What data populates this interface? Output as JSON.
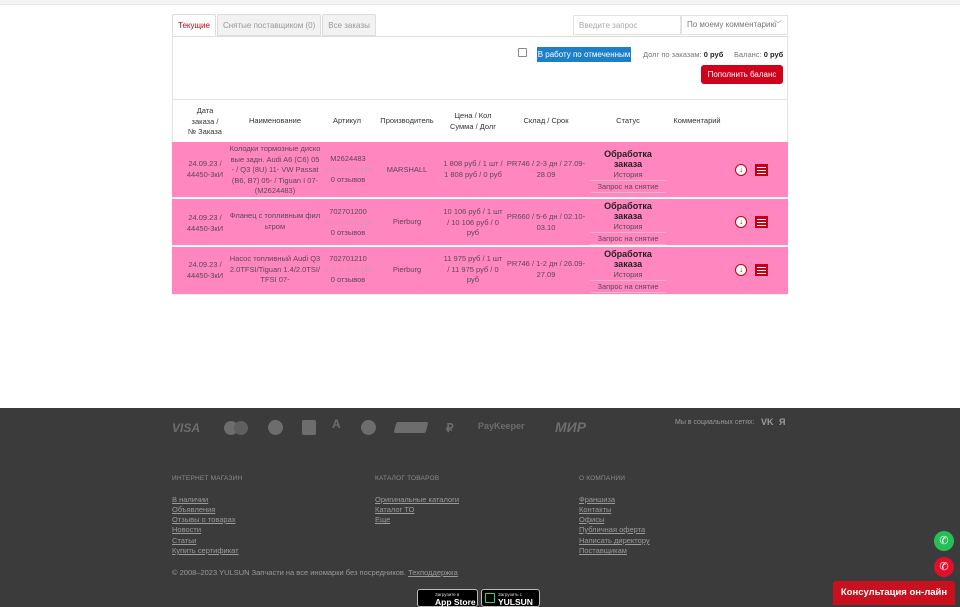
{
  "tabs": [
    {
      "label": "Текущие"
    },
    {
      "label": "Снятые поставщиком (0)"
    },
    {
      "label": "Все заказы"
    }
  ],
  "search": {
    "placeholder": "Введите запрос"
  },
  "filter": {
    "selected": "По моему комментарию"
  },
  "toolbar": {
    "bulk_button": "В работу по отмеченным",
    "debt_label": "Долг по заказам:",
    "debt_value": "0  руб",
    "balance_label": "Баланс:",
    "balance_value": "0  руб",
    "topup_button": "Пополнить баланс"
  },
  "table": {
    "headers": {
      "date": [
        "Дата",
        "заказа /",
        "№ Заказа"
      ],
      "name": "Наименование",
      "article": "Артикул",
      "maker": "Производитель",
      "price": [
        "Цена / Кол",
        "Сумма / Долг"
      ],
      "stock": "Склад / Срок",
      "status": "Статус",
      "comment": "Комментарий"
    },
    "rows": [
      {
        "date": [
          "24.09.23 /",
          "44450-3кИ"
        ],
        "name": [
          "Колодки тормозные диско",
          "вые задн. Audi A6 (C6) 05",
          "- / Q3 (8U) 11- VW Passat",
          "(B6, B7) 05- / Tiguan I 07-",
          "(M2624483)"
        ],
        "article": "M2624483",
        "stars": "☆☆☆☆☆(0)",
        "reviews": "0 отзывов",
        "maker": "MARSHALL",
        "price": [
          "1 808 руб / 1 шт /",
          "1 808 руб / 0 руб"
        ],
        "stock": [
          "PR746 / 2-3 дн / 27.09-",
          "28.09"
        ],
        "status": [
          "Обработка",
          "заказа"
        ],
        "history": "История",
        "request": "Запрос на снятие"
      },
      {
        "date": [
          "24.09.23 /",
          "44450-3кИ"
        ],
        "name": [
          "Фланец с топливным фил",
          "ьтром"
        ],
        "article": "702701200",
        "stars": "☆☆☆☆☆(0)",
        "reviews": "0 отзывов",
        "maker": "Pierburg",
        "price": [
          "10 106 руб / 1 шт",
          "/ 10 106 руб / 0",
          "руб"
        ],
        "stock": [
          "PR660 / 5-6 дн / 02.10-",
          "03.10"
        ],
        "status": [
          "Обработка",
          "заказа"
        ],
        "history": "История",
        "request": "Запрос на снятие"
      },
      {
        "date": [
          "24.09.23 /",
          "44450-3кИ"
        ],
        "name": [
          "Насос топливный Audi Q3",
          "2.0TFSI/Tiguan 1.4/2.0TSI/",
          "TFSI 07-"
        ],
        "article": "702701210",
        "stars": "☆☆☆☆☆(0)",
        "reviews": "0 отзывов",
        "maker": "Pierburg",
        "price": [
          "11 975 руб / 1 шт",
          "/ 11 975 руб / 0",
          "руб"
        ],
        "stock": [
          "PR746 / 1-2 дн / 26.09-",
          "27.09"
        ],
        "status": [
          "Обработка",
          "заказа"
        ],
        "history": "История",
        "request": "Запрос на снятие"
      }
    ]
  },
  "footer": {
    "payments": [
      "VISA",
      "PayKeeper",
      "МИР"
    ],
    "social_label": "Мы в социальных сетях:",
    "social": [
      "VK",
      "Я"
    ],
    "col1": {
      "title": "ИНТЕРНЕТ МАГАЗИН",
      "links": [
        "В наличии",
        "Объявления",
        "Отзывы о товарах",
        "Новости",
        "Статьи",
        "Купить сертификат"
      ]
    },
    "col2": {
      "title": "КАТАЛОГ ТОВАРОВ",
      "links": [
        "Оригинальные каталоги",
        "Каталог ТО",
        "Еще"
      ]
    },
    "col3": {
      "title": "О КОМПАНИИ",
      "links": [
        "Франшиза",
        "Контакты",
        "Офисы",
        "Публичная оферта",
        "Написать директору",
        "Поставщикам"
      ]
    },
    "copyright": "© 2008–2023 YULSUN Запчасти на все иномарки без посредников.",
    "copyright_link": "Техподдержка",
    "appstore": {
      "small": "Загрузите в",
      "big": "App Store"
    },
    "yulsun_app": {
      "small": "Загрузить с",
      "big": "YULSUN"
    }
  },
  "widgets": {
    "consult": "Консультация он-лайн"
  },
  "colors": {
    "accent": "#d0021b",
    "blue": "#1e7fc9",
    "row_highlight": "#ff86bf",
    "footer_bg": "#3b3b3b"
  }
}
